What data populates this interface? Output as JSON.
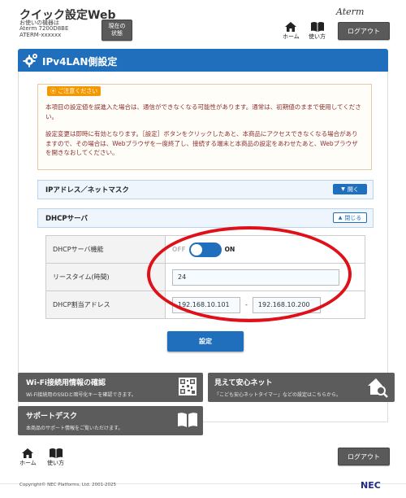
{
  "header": {
    "app_title": "クイック設定Web",
    "device_label": "お使いの機器は",
    "device_model": "Aterm 7200D8BE",
    "device_id": "ATERM-xxxxxx",
    "status_button_line1": "現在の",
    "status_button_line2": "状態",
    "home_label": "ホーム",
    "howto_label": "使い方",
    "logo_text": "Aterm",
    "logout_label": "ログアウト"
  },
  "page": {
    "title": "IPv4LAN側設定",
    "caution_badge": "ご注意ください",
    "caution_p1": "本項目の設定値を誤進入た場合は、通信ができなくなる可能性があります。通常は、初期値のままで使用してください。",
    "caution_p2": "設定変更は即時に有効となります。［設定］ボタンをクリックしたあと、本商品にアクセスできなくなる場合がありますので、その場合は、Webブラウザを一度終了し、接続する端末と本商品の設定をあわせたあと、Webブラウザを開きなおしてください。"
  },
  "sections": {
    "ip_section_label": "IPアドレス／ネットマスク",
    "open_button": "開く",
    "dhcp_section_label": "DHCPサーバ",
    "close_button": "閉じる"
  },
  "dhcp": {
    "server_label": "DHCPサーバ機能",
    "toggle_off_text": "OFF",
    "toggle_on_text": "ON",
    "toggle_state": "on",
    "lease_label": "リースタイム(時間)",
    "lease_value": "24",
    "range_label": "DHCP割当アドレス",
    "range_start": "192.168.10.101",
    "range_separator": "-",
    "range_end": "192.168.10.200"
  },
  "submit_label": "設定",
  "cards": {
    "wifi_title": "Wi-Fi接続用情報の確認",
    "wifi_desc": "Wi-Fi接続用のSSIDと暗号化キーを確認できます。",
    "safe_title": "見えて安心ネット",
    "safe_desc": "「こども安心ネットタイマー」などの設定はこちらから。",
    "support_title": "サポートデスク",
    "support_desc": "本商品のサポート情報をご覧いただけます。"
  },
  "footer": {
    "home_label": "ホーム",
    "howto_label": "使い方",
    "logout_label": "ログアウト",
    "copyright": "Copyright© NEC Platforms, Ltd. 2001-2025",
    "brand": "NEC"
  },
  "colors": {
    "primary_blue": "#1f6fbd",
    "caution_orange": "#f39800",
    "annotation_red": "#e0101a",
    "card_gray": "#5c5c5c"
  }
}
